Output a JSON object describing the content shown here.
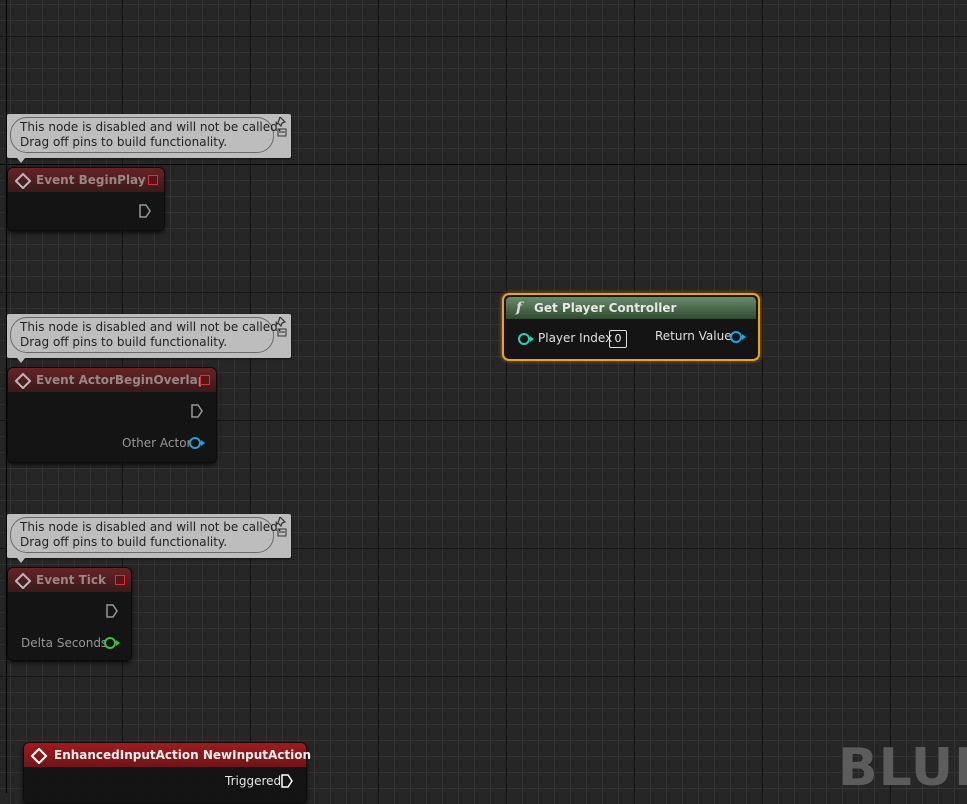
{
  "comments": [
    {
      "line1": "This node is disabled and will not be called.",
      "line2": "Drag off pins to build functionality."
    },
    {
      "line1": "This node is disabled and will not be called.",
      "line2": "Drag off pins to build functionality."
    },
    {
      "line1": "This node is disabled and will not be called.",
      "line2": "Drag off pins to build functionality."
    }
  ],
  "nodes": {
    "begin_play": {
      "title": "Event BeginPlay"
    },
    "actor_begin_overlap": {
      "title": "Event ActorBeginOverlap",
      "pin_other_actor": "Other Actor"
    },
    "tick": {
      "title": "Event Tick",
      "pin_delta_seconds": "Delta Seconds"
    },
    "enhanced_input": {
      "title": "EnhancedInputAction NewInputAction",
      "pin_triggered": "Triggered"
    },
    "get_player_controller": {
      "title": "Get Player Controller",
      "pin_player_index": "Player Index",
      "player_index_value": "0",
      "pin_return_value": "Return Value"
    }
  },
  "watermark": "BLUE",
  "colors": {
    "selection_outline": "#f2a21a",
    "event_header": "#a01a1e",
    "function_header": "#6a8a6a",
    "object_pin": "#26a0e0",
    "float_pin": "#3cc43c",
    "int_pin": "#2dd0b0"
  }
}
